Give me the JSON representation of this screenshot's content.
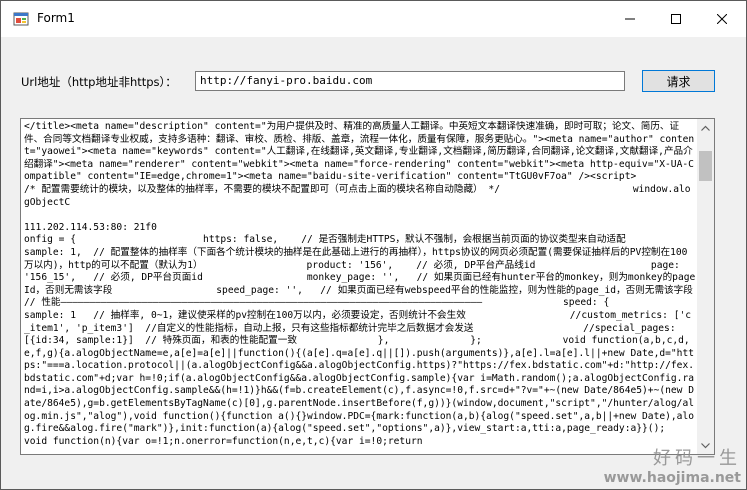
{
  "window": {
    "title": "Form1",
    "app_icon": "winforms-app-icon"
  },
  "controls": {
    "minimize_icon": "minimize-icon",
    "maximize_icon": "maximize-icon",
    "close_icon": "close-icon"
  },
  "form": {
    "url_label": "Url地址（http地址非https）：",
    "url_value": "http://fanyi-pro.baidu.com",
    "request_button": "请求"
  },
  "output": {
    "text": "</title><meta name=\"description\" content=\"为用户提供及时、精准的高质量人工翻译。中英短文本翻译快速准确，即时可取；论文、简历、证件、合同等文档翻译专业权威，支持多语种：翻译、审校、质检、排版、盖章，流程一体化，质量有保障，服务更贴心。\"><meta name=\"author\" content=\"yaowei\"><meta name=\"keywords\" content=\"人工翻译,在线翻译,英文翻译,专业翻译,文档翻译,简历翻译,合同翻译,论文翻译,文献翻译,产品介绍翻译\"><meta name=\"renderer\" content=\"webkit\"><meta name=\"force-rendering\" content=\"webkit\"><meta http-equiv=\"X-UA-Compatible\" content=\"IE=edge,chrome=1\"><meta name=\"baidu-site-verification\" content=\"TtGU0vF7oa\" /><script>                    /* 配置需要统计的模块，以及整体的抽样率，不需要的模块不配置即可（可点击上面的模块名称自动隐藏） */                       window.alogObjectC\n\n111.202.114.53:80: 21f0\nonfig = {                      https: false,    // 是否强制走HTTPS，默认不强制，会根据当前页面的协议类型来自动适配                  sample: 1,  // 配置整体的抽样率（下面各个统计模块的抽样是在此基础上进行的再抽样），https协议的网页必须配置(需要保证抽样后的PV控制在100万以内)，http的可以不配置（默认为1）                  product: '156',    // 必须, DP平台产品线id                    page: '156_15',   // 必须, DP平台页面id                  monkey_page: '',   // 如果页面已经有hunter平台的monkey，则为monkey的pageId，否则无需该字段                  speed_page: '',   // 如果页面已经有webspeed平台的性能监控，则为性能的page_id，否则无需该字段                  // 性能—————————————————————————————————————————————————————————————————————————              speed: {                    sample: 1   // 抽样率, 0~1，建议使采样的pv控制在100万以内，必须要设定，否则统计不会生效                  //custom_metrics: ['c_item1', 'p_item3']  //自定义的性能指标，自动上报，只有这些指标都统计完毕之后数据才会发送                   //special_pages: [{id:34, sample:1}]  // 特殊页面，和表的性能配置一致              },              };              void function(a,b,c,d,e,f,g){a.alogObjectName=e,a[e]=a[e]||function(){(a[e].q=a[e].q||[]).push(arguments)},a[e].l=a[e].l||+new Date,d=\"https:\"===a.location.protocol||(a.alogObjectConfig&&a.alogObjectConfig.https)?\"https://fex.bdstatic.com\"+d:\"http://fex.bdstatic.com\"+d;var h=!0;if(a.alogObjectConfig&&a.alogObjectConfig.sample){var i=Math.random();a.alogObjectConfig.rand=i,i>a.alogObjectConfig.sample&&(h=!1)}h&&(f=b.createElement(c),f.async=!0,f.src=d+\"?v=\"+~(new Date/864e5)+~(new Date/864e5),g=b.getElementsByTagName(c)[0],g.parentNode.insertBefore(f,g))}(window,document,\"script\",\"/hunter/alog/alog.min.js\",\"alog\"),void function(){function a(){}window.PDC={mark:function(a,b){alog(\"speed.set\",a,b||+new Date),alog.fire&&alog.fire(\"mark\")},init:function(a){alog(\"speed.set\",\"options\",a)},view_start:a,tti:a,page_ready:a}}();           void function(n){var o=!1;n.onerror=function(n,e,t,c){var i=!0;return"
  },
  "watermark": {
    "text": "好码一生",
    "url": "www.haojima.net"
  },
  "scrollbar": {
    "up_icon": "scroll-up-arrow-icon",
    "down_icon": "scroll-down-arrow-icon"
  }
}
